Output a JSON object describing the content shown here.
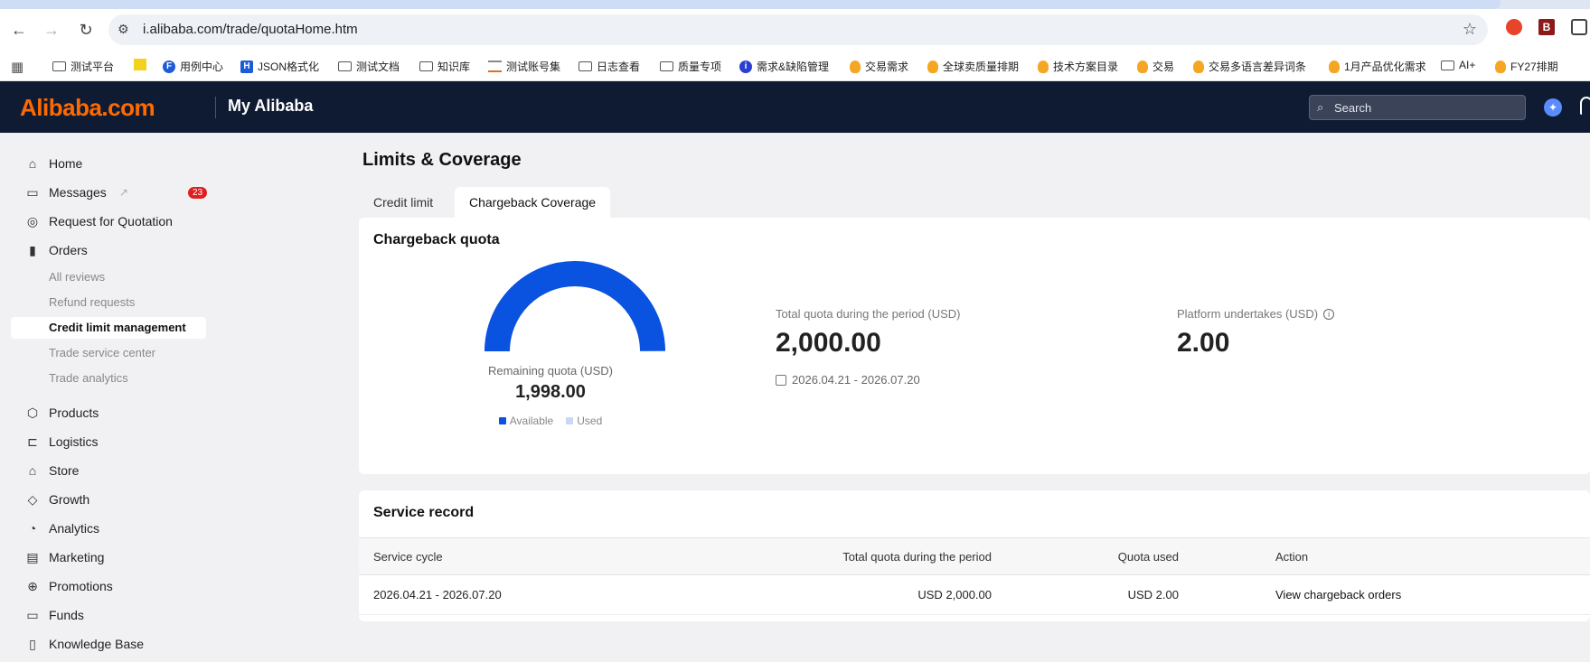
{
  "browser": {
    "url": "i.alibaba.com/trade/quotaHome.htm",
    "bookmarks": [
      "测试平台",
      "",
      "用例中心",
      "JSON格式化",
      "测试文档",
      "知识库",
      "测试账号集",
      "日志查看",
      "质量专项",
      "需求&缺陷管理",
      "交易需求",
      "全球卖质量排期",
      "技术方案目录",
      "交易",
      "交易多语言差异词条",
      "1月产品优化需求",
      "AI+",
      "FY27排期"
    ]
  },
  "header": {
    "logo": "Alibaba.com",
    "section": "My Alibaba",
    "search_placeholder": "Search"
  },
  "sidebar": {
    "home": "Home",
    "messages": "Messages",
    "messages_badge": "23",
    "rfq": "Request for Quotation",
    "orders": "Orders",
    "orders_sub": [
      "All reviews",
      "Refund requests",
      "Credit limit management",
      "Trade service center",
      "Trade analytics"
    ],
    "products": "Products",
    "logistics": "Logistics",
    "store": "Store",
    "growth": "Growth",
    "analytics": "Analytics",
    "marketing": "Marketing",
    "promotions": "Promotions",
    "funds": "Funds",
    "knowledge_base": "Knowledge Base"
  },
  "main": {
    "title": "Limits & Coverage",
    "tabs": [
      "Credit limit",
      "Chargeback Coverage"
    ],
    "active_tab": "Chargeback Coverage",
    "quota_card": {
      "title": "Chargeback quota",
      "remaining_label": "Remaining quota (USD)",
      "remaining_value": "1,998.00",
      "legend_available": "Available",
      "legend_used": "Used",
      "available_fraction": 0.999,
      "color_available": "#0a52e0",
      "color_used": "#c9d8f7",
      "total_label": "Total quota during the period (USD)",
      "total_value": "2,000.00",
      "period": "2026.04.21 - 2026.07.20",
      "platform_label": "Platform undertakes (USD)",
      "platform_value": "2.00"
    },
    "service_record": {
      "title": "Service record",
      "columns": [
        "Service cycle",
        "Total quota during the period",
        "Quota used",
        "Action"
      ],
      "rows": [
        [
          "2026.04.21 - 2026.07.20",
          "USD 2,000.00",
          "USD 2.00",
          "View chargeback orders"
        ]
      ]
    }
  }
}
